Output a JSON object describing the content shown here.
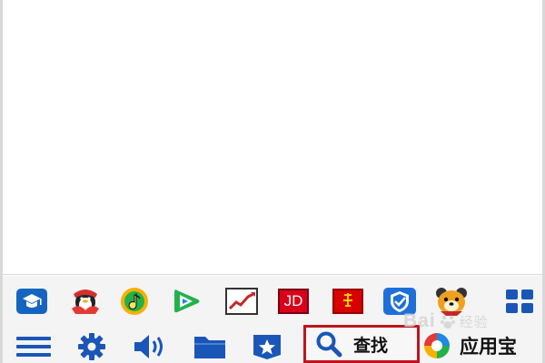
{
  "taskbar": {
    "apps": [
      {
        "icon": "tencent-classroom-icon",
        "color": "#1565c0"
      },
      {
        "icon": "qq-penguin-icon",
        "color": "#c62828"
      },
      {
        "icon": "qq-music-icon",
        "color": "#f9b000"
      },
      {
        "icon": "tencent-video-icon",
        "color": "#21b24b"
      },
      {
        "icon": "stock-chart-icon",
        "color": "#c62828"
      },
      {
        "icon": "jd-icon",
        "color": "#d9001b",
        "text": "JD"
      },
      {
        "icon": "red-book-icon",
        "color": "#d90000"
      },
      {
        "icon": "security-shield-icon",
        "color": "#1e6fd9"
      },
      {
        "icon": "mascot-bear-icon",
        "color": "#f0a020"
      },
      {
        "icon": "grid-apps-icon",
        "color": "#1a56b8"
      }
    ],
    "tools": [
      {
        "icon": "menu-icon"
      },
      {
        "icon": "gear-icon"
      },
      {
        "icon": "volume-icon"
      },
      {
        "icon": "folder-icon"
      },
      {
        "icon": "star-icon"
      }
    ],
    "search": {
      "icon": "search-icon",
      "label": "查找",
      "highlight_color": "#c0141c"
    },
    "appstore": {
      "icon": "appstore-icon",
      "label": "应用宝"
    },
    "watermark": {
      "latin": "Bai",
      "cn": "经验"
    },
    "accent": "#1a56b8"
  }
}
